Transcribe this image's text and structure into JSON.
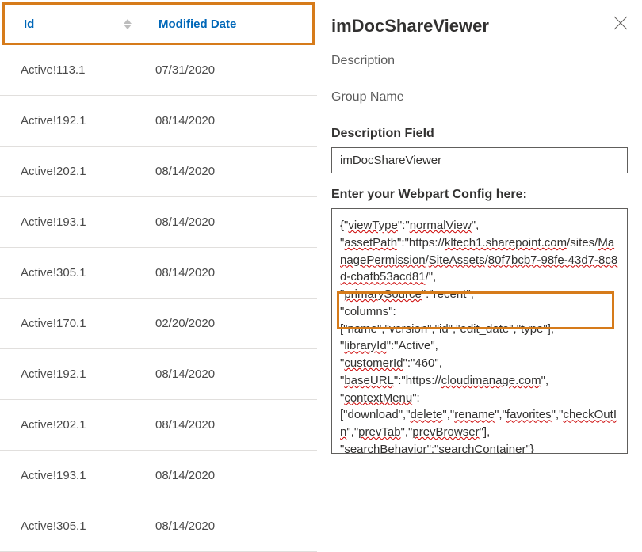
{
  "table": {
    "headers": {
      "id": "Id",
      "modified": "Modified Date"
    },
    "rows": [
      {
        "id": "Active!113.1",
        "date": "07/31/2020"
      },
      {
        "id": "Active!192.1",
        "date": "08/14/2020"
      },
      {
        "id": "Active!202.1",
        "date": "08/14/2020"
      },
      {
        "id": "Active!193.1",
        "date": "08/14/2020"
      },
      {
        "id": "Active!305.1",
        "date": "08/14/2020"
      },
      {
        "id": "Active!170.1",
        "date": "02/20/2020"
      },
      {
        "id": "Active!192.1",
        "date": "08/14/2020"
      },
      {
        "id": "Active!202.1",
        "date": "08/14/2020"
      },
      {
        "id": "Active!193.1",
        "date": "08/14/2020"
      },
      {
        "id": "Active!305.1",
        "date": "08/14/2020"
      }
    ]
  },
  "panel": {
    "title": "imDocShareViewer",
    "descriptionLabel": "Description",
    "groupNameLabel": "Group Name",
    "descriptionFieldLabel": "Description Field",
    "descriptionFieldValue": "imDocShareViewer",
    "configLabel": "Enter your Webpart Config here:",
    "config": {
      "line1a": "{\"",
      "viewType": "viewType",
      "line1b": "\":\"",
      "normalView": "normalView",
      "line1c": "\",",
      "assetPath": "assetPath",
      "url_seg1": "kltech1.sharepoint.com",
      "url_seg2": "ManagePermission",
      "url_seg3": "SiteAssets",
      "url_seg4": "80f7bcb7-98fe-43d7-8c8d-cbafb53acd81",
      "primarySource": "primarySource",
      "columns": "columns",
      "columns_list": "[\"name\",\"version\",\"id\",\"edit_date\",\"type\"],",
      "libraryId": "libraryId",
      "libraryId_v": "\":\"Active\",",
      "customerId": "customerId",
      "customerId_v": "\":\"460\",",
      "baseURL": "baseURL",
      "cloudimanage": "cloudimanage.com",
      "contextMenu": "contextMenu",
      "cm_delete": "delete",
      "cm_rename": "rename",
      "cm_favorites": "favorites",
      "cm_checkOutIn": "checkOutIn",
      "cm_prevTab": "prevTab",
      "cm_prevBrowser": "prevBrowser",
      "searchBehavior": "searchBehavior",
      "searchContainer": "searchContainer"
    }
  }
}
